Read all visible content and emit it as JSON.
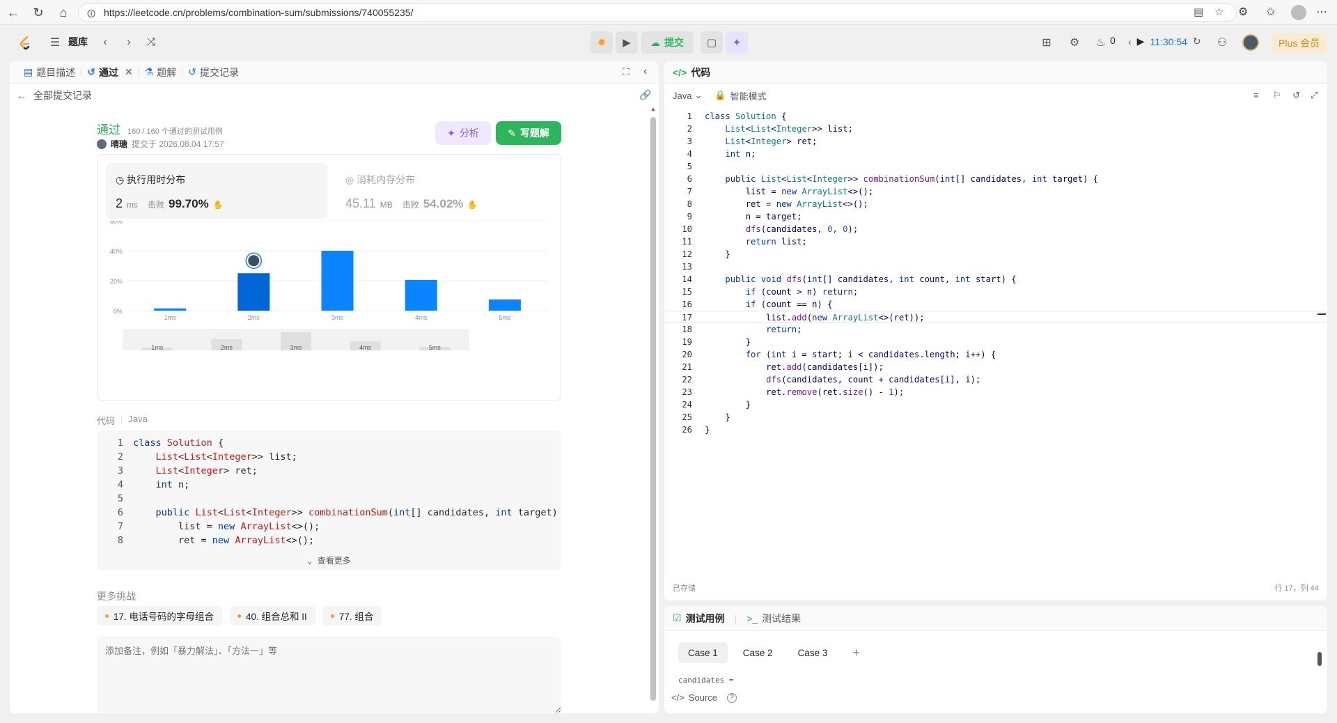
{
  "browser": {
    "url": "https://leetcode.cn/problems/combination-sum/submissions/740055235/"
  },
  "header": {
    "problem_bank": "题库",
    "submit_label": "提交",
    "fire_count": "0",
    "timer": "11:30:54",
    "plus_label": "Plus 会员"
  },
  "left_tabs": [
    {
      "label": "题目描述"
    },
    {
      "label": "通过"
    },
    {
      "label": "题解"
    },
    {
      "label": "提交记录"
    }
  ],
  "back_label": "全部提交记录",
  "submission": {
    "status": "通过",
    "tests": "160 / 160 个通过的测试用例",
    "submitter": "晴瑭",
    "submitted_at": "提交于 2026.08.04 17:57",
    "analyze_label": "分析",
    "write_solution_label": "写题解"
  },
  "runtime": {
    "title": "执行用时分布",
    "value": "2",
    "unit": "ms",
    "beats_label": "击败",
    "beats_pct": "99.70%"
  },
  "memory": {
    "title": "消耗内存分布",
    "value": "45.11",
    "unit": "MB",
    "beats_label": "击败",
    "beats_pct": "54.02%"
  },
  "chart_data": {
    "type": "bar",
    "categories": [
      "1ms",
      "2ms",
      "3ms",
      "4ms",
      "5ms"
    ],
    "values": [
      1.5,
      25,
      40,
      20.5,
      7.5
    ],
    "ylim": [
      0,
      60
    ],
    "yticks": [
      "0%",
      "20%",
      "40%",
      "60%"
    ],
    "highlight": "2ms",
    "colors": {
      "bar": "#0a84ff",
      "highlight": "#0066d6"
    },
    "navigator_values": [
      1.5,
      25,
      40,
      20.5,
      7.5
    ]
  },
  "code_section": {
    "label": "代码",
    "language": "Java",
    "view_more": "查看更多",
    "preview_lines": [
      "class Solution {",
      "    List<List<Integer>> list;",
      "    List<Integer> ret;",
      "    int n;",
      "",
      "    public List<List<Integer>> combinationSum(int[] candidates, int target)",
      "        list = new ArrayList<>();",
      "        ret = new ArrayList<>();"
    ]
  },
  "more_challenges": {
    "title": "更多挑战",
    "items": [
      "17. 电话号码的字母组合",
      "40. 组合总和 II",
      "77. 组合"
    ]
  },
  "note_placeholder": "添加备注，例如「暴力解法」、「方法一」等",
  "editor": {
    "title": "代码",
    "language": "Java",
    "mode": "智能模式",
    "saved": "已存储",
    "cursor": "行 17，列 44",
    "current_line": 17,
    "lines": [
      "class Solution {",
      "    List<List<Integer>> list;",
      "    List<Integer> ret;",
      "    int n;",
      "",
      "    public List<List<Integer>> combinationSum(int[] candidates, int target) {",
      "        list = new ArrayList<>();",
      "        ret = new ArrayList<>();",
      "        n = target;",
      "        dfs(candidates, 0, 0);",
      "        return list;",
      "    }",
      "",
      "    public void dfs(int[] candidates, int count, int start) {",
      "        if (count > n) return;",
      "        if (count == n) {",
      "            list.add(new ArrayList<>(ret));",
      "            return;",
      "        }",
      "        for (int i = start; i < candidates.length; i++) {",
      "            ret.add(candidates[i]);",
      "            dfs(candidates, count + candidates[i], i);",
      "            ret.remove(ret.size() - 1);",
      "        }",
      "    }",
      "}"
    ]
  },
  "test_panel": {
    "tab_cases": "测试用例",
    "tab_results": "测试结果",
    "cases": [
      "Case 1",
      "Case 2",
      "Case 3"
    ],
    "add_symbol": "+",
    "candidates_label": "candidates =",
    "source_label": "Source"
  }
}
